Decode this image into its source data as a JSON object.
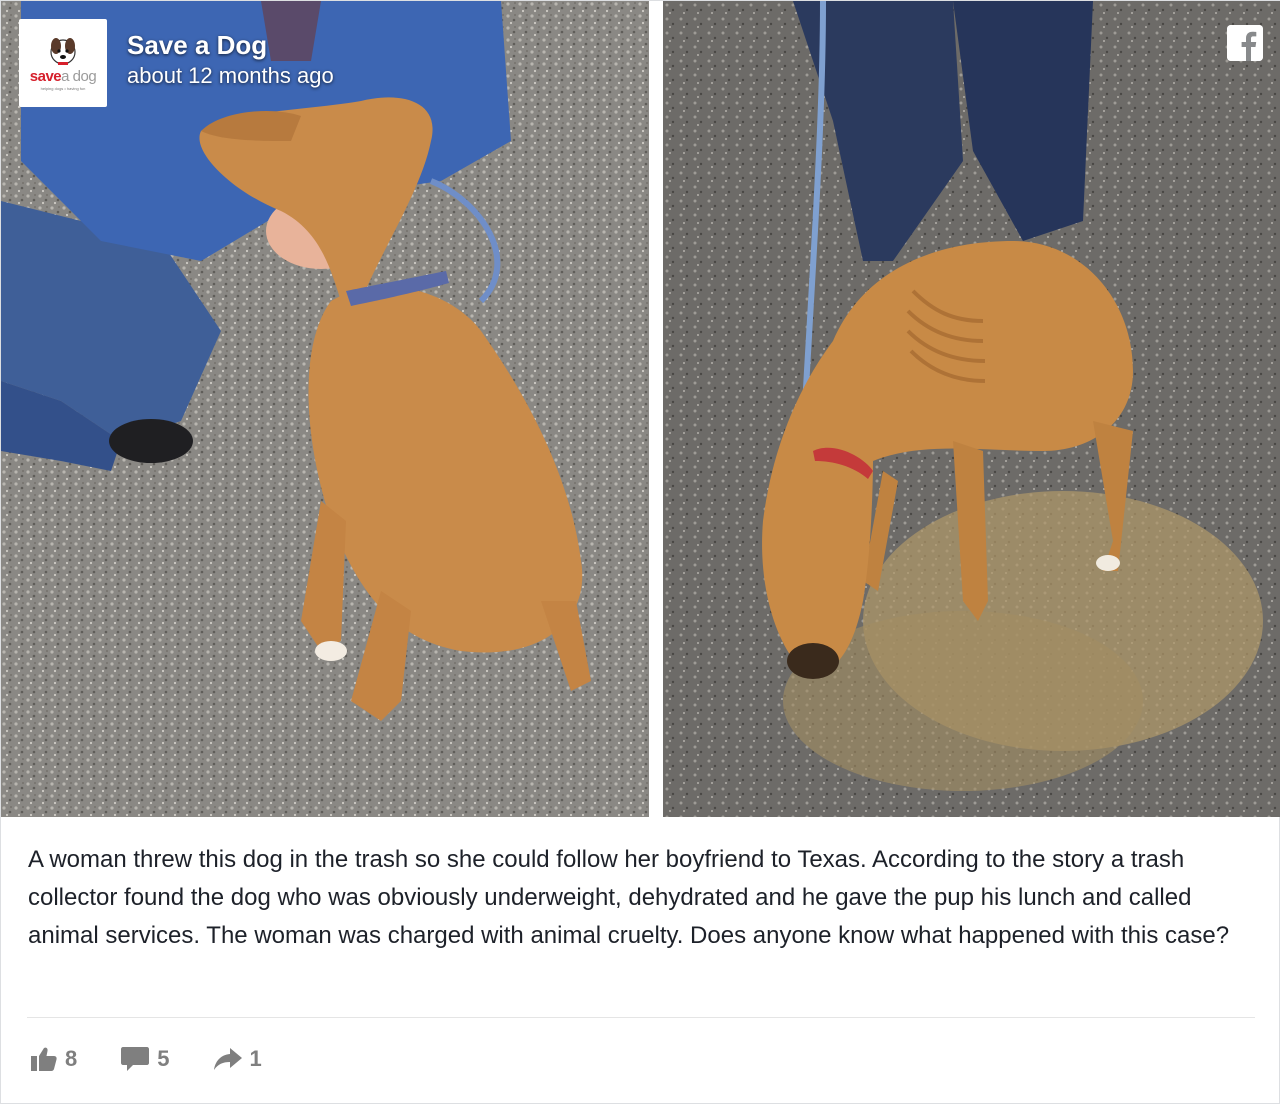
{
  "post": {
    "page_name": "Save a Dog",
    "time": "about 12 months ago",
    "logo": {
      "word_save": "save",
      "word_dog": "a dog",
      "tagline": "helping dogs • having fun"
    },
    "text": "A woman threw this dog in the trash so she could follow her boyfriend to Texas. According to the story a trash collector found the dog who was obviously underweight, dehydrated and he gave the pup his lunch and called animal services. The woman was charged with animal cruelty. Does anyone know what happened with this case?",
    "stats": {
      "likes": "8",
      "comments": "5",
      "shares": "1"
    }
  },
  "icons": {
    "facebook": "facebook-icon",
    "like": "thumbs-up-icon",
    "comment": "comment-icon",
    "share": "share-arrow-icon"
  },
  "colors": {
    "brand_red": "#d61f2b",
    "stat_gray": "#7f7f7f",
    "text": "#1d2129"
  }
}
